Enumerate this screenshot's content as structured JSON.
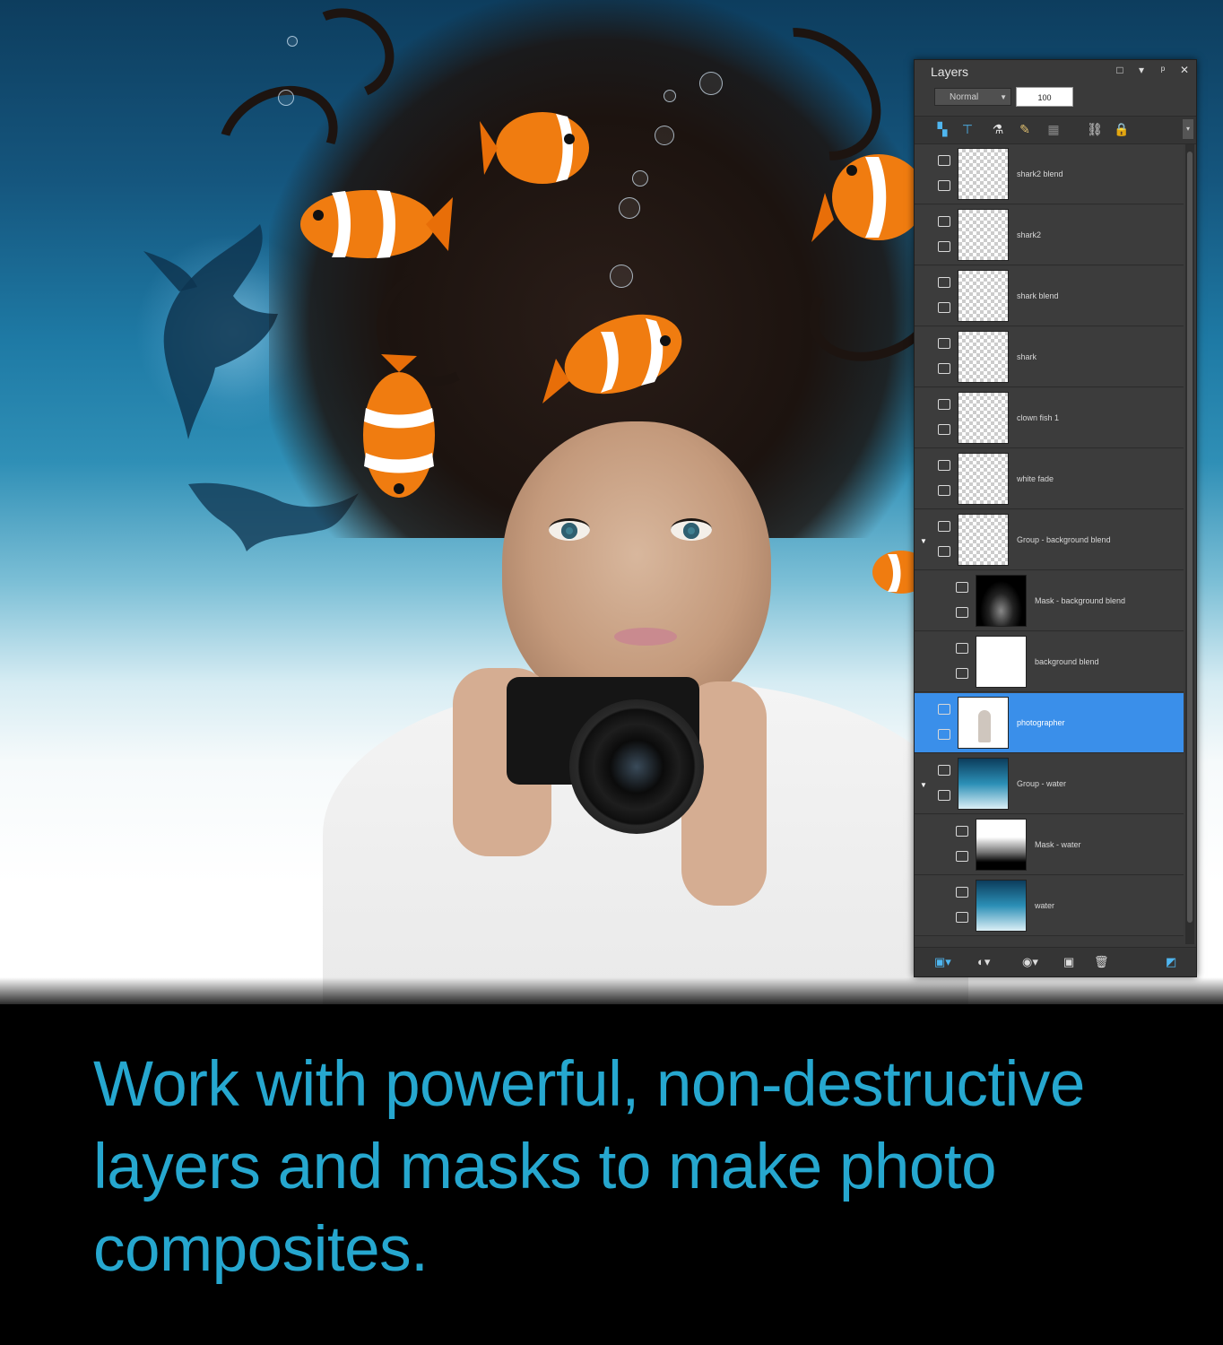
{
  "layers_panel": {
    "title": "Layers",
    "blend_mode": "Normal",
    "opacity": "100",
    "title_buttons": [
      "□",
      "▾",
      "ᵖ",
      "✕"
    ],
    "toolbar_icons": [
      "new-raster-layer-icon",
      "new-vector-layer-icon",
      "new-adjustment-layer-icon",
      "new-mask-icon",
      "new-group-icon",
      "link-icon",
      "lock-icon"
    ],
    "layers": [
      {
        "name": "shark2 blend",
        "type": "raster",
        "thumb": "checker",
        "indent": false,
        "selected": false
      },
      {
        "name": "shark2",
        "type": "raster",
        "thumb": "checker",
        "indent": false,
        "selected": false
      },
      {
        "name": "shark blend",
        "type": "raster",
        "thumb": "checker",
        "indent": false,
        "selected": false
      },
      {
        "name": "shark",
        "type": "raster",
        "thumb": "checker",
        "indent": false,
        "selected": false
      },
      {
        "name": "clown fish 1",
        "type": "raster",
        "thumb": "checker",
        "indent": false,
        "selected": false
      },
      {
        "name": "white fade",
        "type": "raster",
        "thumb": "checker",
        "indent": false,
        "selected": false
      },
      {
        "name": "Group - background blend",
        "type": "group",
        "thumb": "checker",
        "indent": false,
        "selected": false
      },
      {
        "name": "Mask - background blend",
        "type": "mask",
        "thumb": "mask-bg",
        "indent": true,
        "selected": false
      },
      {
        "name": "background blend",
        "type": "raster",
        "thumb": "white",
        "indent": true,
        "selected": false
      },
      {
        "name": "photographer",
        "type": "raster",
        "thumb": "photog",
        "indent": false,
        "selected": true
      },
      {
        "name": "Group - water",
        "type": "group",
        "thumb": "water",
        "indent": false,
        "selected": false
      },
      {
        "name": "Mask - water",
        "type": "mask",
        "thumb": "mask-water",
        "indent": true,
        "selected": false
      },
      {
        "name": "water",
        "type": "raster",
        "thumb": "water",
        "indent": true,
        "selected": false
      }
    ]
  },
  "caption": "Work with powerful, non-destructive layers and masks to make photo composites.",
  "colors": {
    "caption_text": "#26a7cf",
    "selected_layer": "#3a8fea",
    "panel_bg": "#3a3a3a"
  }
}
